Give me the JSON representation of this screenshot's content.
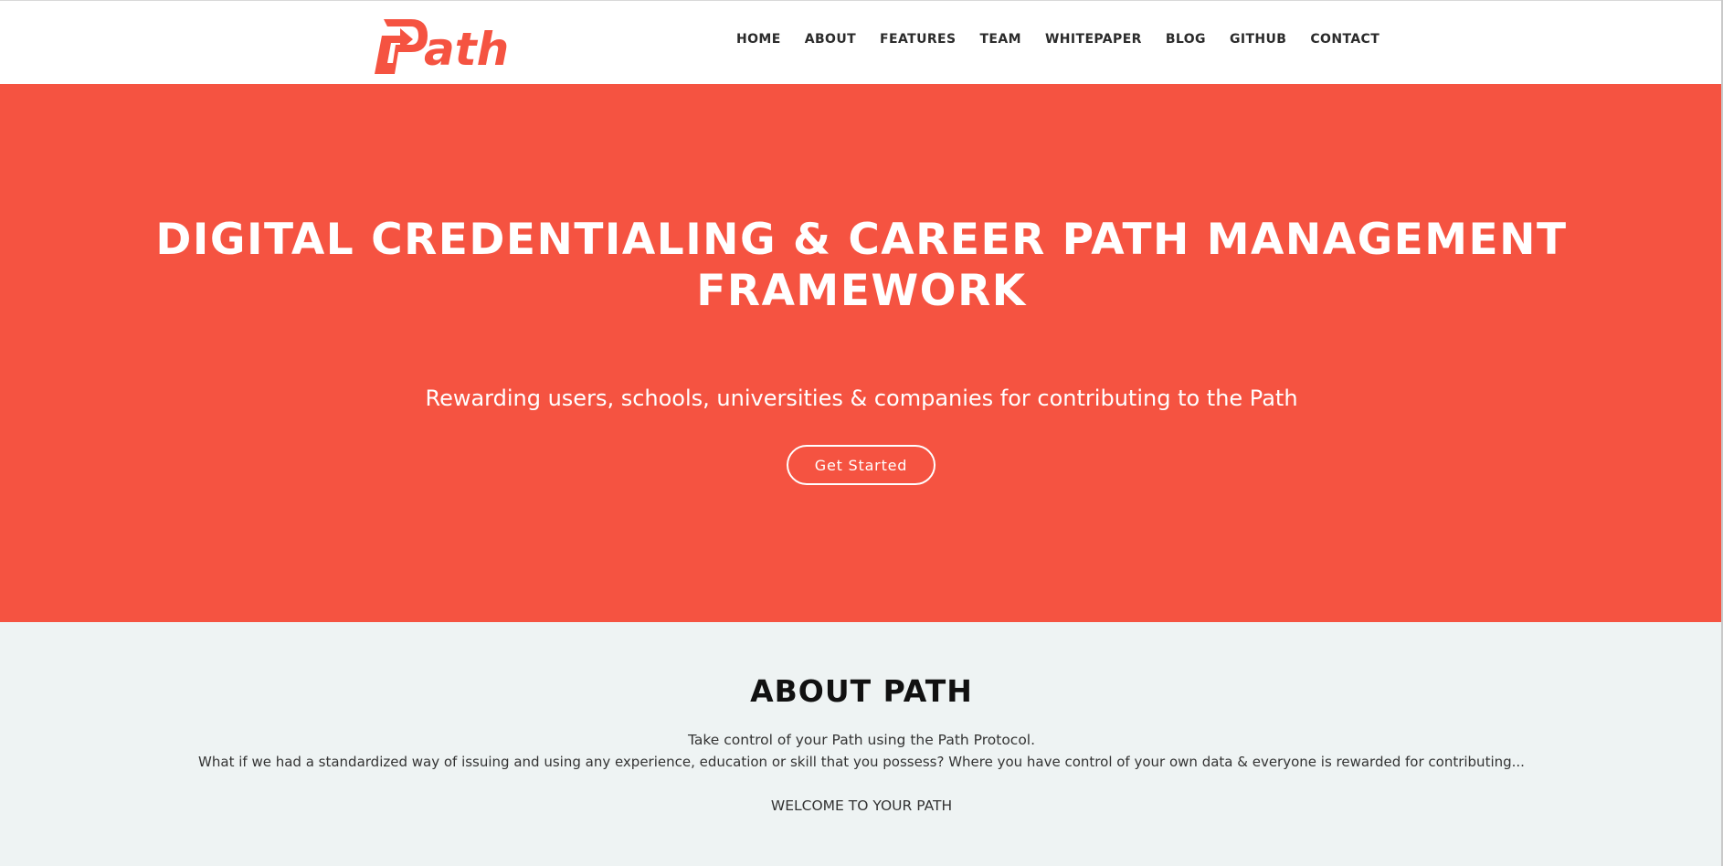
{
  "brand": {
    "name": "Path",
    "accent_color": "#f55341"
  },
  "nav": {
    "items": [
      {
        "label": "HOME"
      },
      {
        "label": "ABOUT"
      },
      {
        "label": "FEATURES"
      },
      {
        "label": "TEAM"
      },
      {
        "label": "WHITEPAPER"
      },
      {
        "label": "BLOG"
      },
      {
        "label": "GITHUB"
      },
      {
        "label": "CONTACT"
      }
    ]
  },
  "hero": {
    "title_line1": "DIGITAL CREDENTIALING & CAREER PATH MANAGEMENT",
    "title_line2": "FRAMEWORK",
    "subtitle": "Rewarding users, schools, universities & companies for contributing to the Path",
    "cta_label": "Get Started",
    "background_color": "#f55341"
  },
  "about": {
    "title": "ABOUT PATH",
    "line1": "Take control of your Path using the Path Protocol.",
    "line2": "What if we had a standardized way of issuing and using any experience, education or skill that you possess? Where you have control of your own data & everyone is rewarded for contributing...",
    "line3": "WELCOME TO YOUR PATH",
    "background_color": "#eef3f3"
  }
}
